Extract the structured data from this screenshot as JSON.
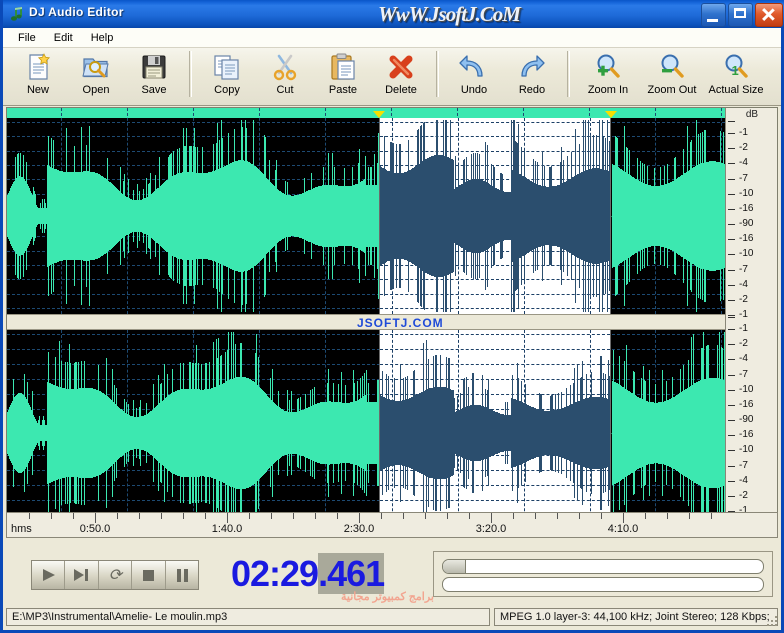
{
  "window": {
    "title": "DJ Audio Editor",
    "watermark": "WwW.JsoftJ.CoM",
    "app_icon": "music-note-icon",
    "minimize_label": "Minimize",
    "maximize_label": "Maximize",
    "close_label": "Close"
  },
  "menu": {
    "items": [
      {
        "label": "File"
      },
      {
        "label": "Edit"
      },
      {
        "label": "Help"
      }
    ]
  },
  "toolbar": {
    "buttons": [
      {
        "label": "New",
        "icon": "new-document-icon"
      },
      {
        "label": "Open",
        "icon": "open-folder-icon"
      },
      {
        "label": "Save",
        "icon": "floppy-disk-icon"
      },
      {
        "label": "Copy",
        "icon": "copy-icon"
      },
      {
        "label": "Cut",
        "icon": "scissors-icon"
      },
      {
        "label": "Paste",
        "icon": "clipboard-icon"
      },
      {
        "label": "Delete",
        "icon": "red-x-icon"
      },
      {
        "label": "Undo",
        "icon": "undo-arrow-icon"
      },
      {
        "label": "Redo",
        "icon": "redo-arrow-icon"
      },
      {
        "label": "Zoom In",
        "icon": "magnifier-plus-icon"
      },
      {
        "label": "Zoom Out",
        "icon": "magnifier-minus-icon"
      },
      {
        "label": "Actual Size",
        "icon": "magnifier-one-icon"
      }
    ]
  },
  "waveform": {
    "db_axis_title": "dB",
    "db_labels": [
      "-1",
      "-2",
      "-4",
      "-7",
      "-10",
      "-16",
      "-90",
      "-16",
      "-10",
      "-7",
      "-4",
      "-2",
      "-1"
    ],
    "channels": [
      "left",
      "right"
    ],
    "waveform_color": "#3ce8b0",
    "selection_waveform_color": "#2b4e6e",
    "background_color": "#000000",
    "selection_background_color": "#ffffff",
    "grid_color": "#1d4a72",
    "center_watermark": "JSOFTJ.COM",
    "selection": {
      "start_time": "2:30.0",
      "end_time": "3:57.0"
    }
  },
  "ruler": {
    "unit_label": "hms",
    "labels": [
      "0:50.0",
      "1:40.0",
      "2:30.0",
      "3:20.0",
      "4:10.0"
    ]
  },
  "transport": {
    "buttons": [
      {
        "name": "play",
        "label": "Play",
        "icon": "play-icon"
      },
      {
        "name": "next",
        "label": "Next",
        "icon": "next-track-icon"
      },
      {
        "name": "loop",
        "label": "Loop",
        "icon": "loop-icon"
      },
      {
        "name": "stop",
        "label": "Stop",
        "icon": "stop-icon"
      },
      {
        "name": "pause",
        "label": "Pause",
        "icon": "pause-icon"
      }
    ]
  },
  "position": {
    "time_main": "02:29",
    "time_ms": ".461",
    "full": "02:29.461"
  },
  "sliders": {
    "progress_value_percent": 7,
    "volume_value_percent": 0
  },
  "overlay_watermark": "برامج كمبيوتر مجانية",
  "status": {
    "file_path": "E:\\MP3\\Instrumental\\Amelie- Le moulin.mp3",
    "format_info": "MPEG 1.0 layer-3: 44,100 kHz; Joint Stereo; 128 Kbps;"
  }
}
